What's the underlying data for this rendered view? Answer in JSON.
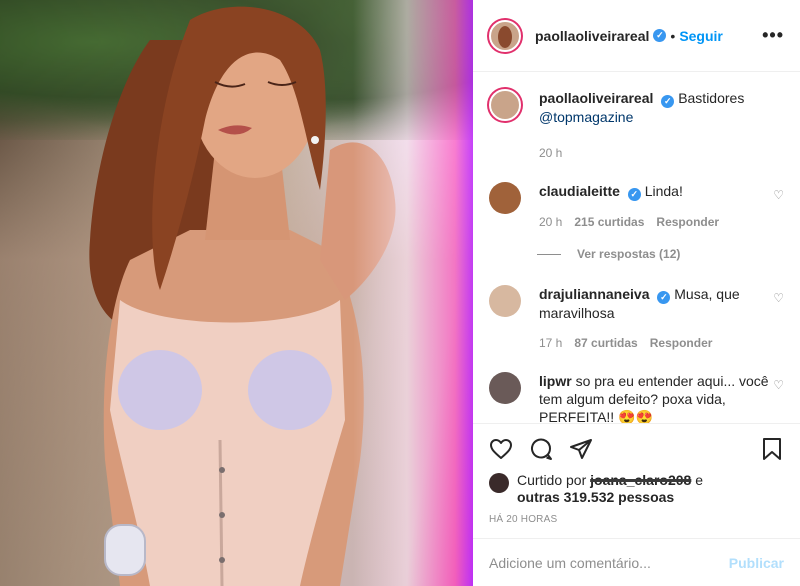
{
  "post_author": {
    "username": "paollaoliveirareal",
    "verified_symbol": "✓",
    "separator": "•",
    "follow_label": "Seguir",
    "more_icon": "more-options-icon"
  },
  "caption": {
    "username": "paollaoliveirareal",
    "text": "Bastidores",
    "mention": "@topmagazine",
    "time": "20 h"
  },
  "comments": [
    {
      "username": "claudialeitte",
      "text": "Linda!",
      "time": "20 h",
      "likes": "215 curtidas",
      "reply_label": "Responder",
      "view_replies": "Ver respostas (12)"
    },
    {
      "username": "drajuliannaneiva",
      "text": "Musa, que maravilhosa",
      "time": "17 h",
      "likes": "87 curtidas",
      "reply_label": "Responder"
    },
    {
      "username": "lipwr",
      "text": "so pra eu entender aqui... você tem algum defeito? poxa vida, PERFEITA!! 😍😍"
    }
  ],
  "likes": {
    "prefix": "Curtido por",
    "liker": "joana_claro208",
    "connector": "e",
    "others": "outras 319.532 pessoas"
  },
  "posted_time": "HÁ 20 HORAS",
  "add_comment": {
    "placeholder": "Adicione um comentário...",
    "publish_label": "Publicar"
  },
  "colors": {
    "accent": "#0095f6",
    "verified": "#3897f0",
    "ring": "#e1306c"
  }
}
